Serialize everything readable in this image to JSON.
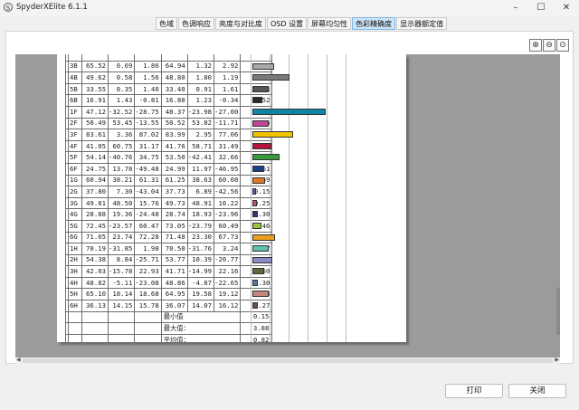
{
  "window": {
    "title": "SpyderXElite 6.1.1",
    "app_icon": "S",
    "minimize": "–",
    "maximize": "☐",
    "close": "✕"
  },
  "tabs": [
    {
      "label": "色域",
      "active": false
    },
    {
      "label": "色调响应",
      "active": false
    },
    {
      "label": "亮度与对比度",
      "active": false
    },
    {
      "label": "OSD 设置",
      "active": false
    },
    {
      "label": "屏幕均匀性",
      "active": false
    },
    {
      "label": "色彩精确度",
      "active": true
    },
    {
      "label": "显示器额定值",
      "active": false
    }
  ],
  "zoom_buttons": [
    {
      "icon": "zoom-in-icon",
      "glyph": "⊕"
    },
    {
      "icon": "zoom-out-icon",
      "glyph": "⊖"
    },
    {
      "icon": "zoom-fit-icon",
      "glyph": "⊙"
    }
  ],
  "report": {
    "rows": [
      {
        "id": "",
        "v": [
          "",
          "",
          "",
          "",
          "",
          ""
        ],
        "de": "",
        "color": "#8a8a8a"
      },
      {
        "id": "3B",
        "v": [
          "65.52",
          "0.69",
          "1.86",
          "64.94",
          "1.32",
          "2.92"
        ],
        "de": "1.15",
        "color": "#a9a9a9"
      },
      {
        "id": "4B",
        "v": [
          "49.62",
          "0.58",
          "1.56",
          "48.80",
          "1.80",
          "1.19"
        ],
        "de": "1.95",
        "color": "#7a7a7a"
      },
      {
        "id": "5B",
        "v": [
          "33.55",
          "0.35",
          "1.40",
          "33.40",
          "0.91",
          "1.61"
        ],
        "de": "0.84",
        "color": "#555555"
      },
      {
        "id": "6B",
        "v": [
          "16.91",
          "1.43",
          "-0.81",
          "16.88",
          "1.23",
          "-0.34"
        ],
        "de": "0.52",
        "color": "#2a2a2a"
      },
      {
        "id": "1F",
        "v": [
          "47.12",
          "-32.52",
          "-28.75",
          "48.37",
          "-23.98",
          "-27.00"
        ],
        "de": "3.88",
        "color": "#0e86a8"
      },
      {
        "id": "2F",
        "v": [
          "50.49",
          "53.45",
          "-13.55",
          "50.52",
          "53.82",
          "-11.71"
        ],
        "de": "0.86",
        "color": "#c2449a"
      },
      {
        "id": "3F",
        "v": [
          "83.61",
          "3.36",
          "87.02",
          "83.99",
          "2.95",
          "77.06"
        ],
        "de": "2.14",
        "color": "#f0c500"
      },
      {
        "id": "4F",
        "v": [
          "41.05",
          "60.75",
          "31.17",
          "41.76",
          "58.71",
          "31.49"
        ],
        "de": "1.01",
        "color": "#b8143b"
      },
      {
        "id": "5F",
        "v": [
          "54.14",
          "-40.76",
          "34.75",
          "53.50",
          "-42.41",
          "32.66"
        ],
        "de": "1.41",
        "color": "#3a9a3c"
      },
      {
        "id": "6F",
        "v": [
          "24.75",
          "13.78",
          "-49.48",
          "24.99",
          "11.97",
          "-46.95"
        ],
        "de": "0.61",
        "color": "#1d3d8f"
      },
      {
        "id": "1G",
        "v": [
          "60.94",
          "38.21",
          "61.31",
          "61.25",
          "38.63",
          "60.08"
        ],
        "de": "0.69",
        "color": "#de7a25"
      },
      {
        "id": "2G",
        "v": [
          "37.80",
          "7.30",
          "-43.04",
          "37.73",
          "6.89",
          "-42.56"
        ],
        "de": "0.15",
        "color": "#5a5aa0"
      },
      {
        "id": "3G",
        "v": [
          "49.81",
          "48.50",
          "15.76",
          "49.73",
          "48.91",
          "16.22"
        ],
        "de": "0.25",
        "color": "#c05262"
      },
      {
        "id": "4G",
        "v": [
          "28.88",
          "19.36",
          "-24.48",
          "28.74",
          "18.93",
          "-23.96"
        ],
        "de": "0.30",
        "color": "#4a2c6a"
      },
      {
        "id": "5G",
        "v": [
          "72.45",
          "-23.57",
          "60.47",
          "73.05",
          "-23.79",
          "60.49"
        ],
        "de": "0.46",
        "color": "#9ac23c"
      },
      {
        "id": "6G",
        "v": [
          "71.65",
          "23.74",
          "72.28",
          "71.48",
          "23.30",
          "67.73"
        ],
        "de": "1.21",
        "color": "#ec9e1f"
      },
      {
        "id": "1H",
        "v": [
          "70.19",
          "-31.85",
          "1.98",
          "70.50",
          "-31.76",
          "3.24"
        ],
        "de": "0.87",
        "color": "#5fc1ad"
      },
      {
        "id": "2H",
        "v": [
          "54.38",
          "8.84",
          "-25.71",
          "53.77",
          "10.39",
          "-26.77"
        ],
        "de": "1.06",
        "color": "#8a8ac4"
      },
      {
        "id": "3H",
        "v": [
          "42.03",
          "-15.78",
          "22.93",
          "41.71",
          "-14.99",
          "22.16"
        ],
        "de": "0.60",
        "color": "#586a3c"
      },
      {
        "id": "4H",
        "v": [
          "48.82",
          "-5.11",
          "-23.08",
          "48.86",
          "-4.87",
          "-22.65"
        ],
        "de": "0.30",
        "color": "#5a78a8"
      },
      {
        "id": "5H",
        "v": [
          "65.10",
          "18.14",
          "18.68",
          "64.95",
          "19.58",
          "19.12"
        ],
        "de": "0.88",
        "color": "#c6887a"
      },
      {
        "id": "6H",
        "v": [
          "36.13",
          "14.15",
          "15.78",
          "36.07",
          "14.07",
          "16.12"
        ],
        "de": "0.27",
        "color": "#6a5048"
      }
    ],
    "summary": [
      {
        "label": "最小值",
        "value": "0.15"
      },
      {
        "label": "最大值：",
        "value": "3.88"
      },
      {
        "label": "平均值：",
        "value": "0.82"
      }
    ]
  },
  "buttons": {
    "print": "打印",
    "close": "关闭"
  }
}
